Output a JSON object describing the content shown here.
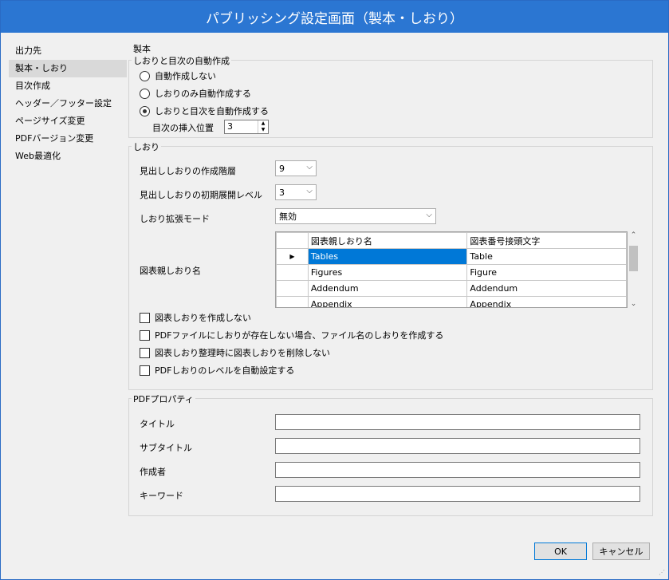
{
  "window": {
    "title": "パブリッシング設定画面（製本・しおり）"
  },
  "sidebar": {
    "items": [
      {
        "label": "出力先",
        "selected": false
      },
      {
        "label": "製本・しおり",
        "selected": true
      },
      {
        "label": "目次作成",
        "selected": false
      },
      {
        "label": "ヘッダー／フッター設定",
        "selected": false
      },
      {
        "label": "ページサイズ変更",
        "selected": false
      },
      {
        "label": "PDFバージョン変更",
        "selected": false
      },
      {
        "label": "Web最適化",
        "selected": false
      }
    ]
  },
  "main": {
    "section_title": "製本",
    "auto_group": {
      "title": "しおりと目次の自動作成",
      "options": [
        {
          "label": "自動作成しない",
          "checked": false
        },
        {
          "label": "しおりのみ自動作成する",
          "checked": false
        },
        {
          "label": "しおりと目次を自動作成する",
          "checked": true
        }
      ],
      "toc_position_label": "目次の挿入位置",
      "toc_position_value": "3"
    },
    "bookmark_group": {
      "title": "しおり",
      "heading_level_label": "見出ししおりの作成階層",
      "heading_level_value": "9",
      "expand_level_label": "見出ししおりの初期展開レベル",
      "expand_level_value": "3",
      "ext_mode_label": "しおり拡張モード",
      "ext_mode_value": "無効",
      "figure_label": "図表親しおり名",
      "table": {
        "columns": [
          "図表親しおり名",
          "図表番号接頭文字"
        ],
        "rows": [
          {
            "name": "Tables",
            "prefix": "Table",
            "current": true
          },
          {
            "name": "Figures",
            "prefix": "Figure",
            "current": false
          },
          {
            "name": "Addendum",
            "prefix": "Addendum",
            "current": false
          },
          {
            "name": "Appendix",
            "prefix": "Appendix",
            "current": false
          }
        ]
      },
      "checkboxes": [
        {
          "label": "図表しおりを作成しない",
          "checked": false
        },
        {
          "label": "PDFファイルにしおりが存在しない場合、ファイル名のしおりを作成する",
          "checked": false
        },
        {
          "label": "図表しおり整理時に図表しおりを削除しない",
          "checked": false
        },
        {
          "label": "PDFしおりのレベルを自動設定する",
          "checked": false
        }
      ]
    },
    "pdf_props": {
      "title": "PDFプロパティ",
      "fields": [
        {
          "label": "タイトル",
          "value": ""
        },
        {
          "label": "サブタイトル",
          "value": ""
        },
        {
          "label": "作成者",
          "value": ""
        },
        {
          "label": "キーワード",
          "value": ""
        }
      ]
    }
  },
  "footer": {
    "ok_label": "OK",
    "cancel_label": "キャンセル"
  },
  "icons": {
    "row_pointer": "▶",
    "chevron_down": "⌵",
    "spin_up": "▲",
    "spin_down": "▼",
    "scroll_up": "⌃",
    "scroll_down": "⌄"
  },
  "colors": {
    "title_bar": "#2b76d2",
    "selection": "#0078d7"
  }
}
